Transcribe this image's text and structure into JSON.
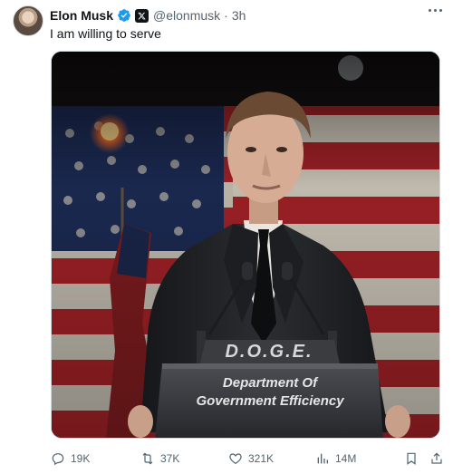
{
  "tweet": {
    "author": {
      "display_name": "Elon Musk",
      "handle": "@elonmusk",
      "verified_color": "#1d9bf0",
      "affiliation_icon": "x-logo-icon"
    },
    "separator": "·",
    "time": "3h",
    "text": "I am willing to serve",
    "media": {
      "podium_title": "D.O.G.E.",
      "podium_line1": "Department Of",
      "podium_line2": "Government Efficiency"
    },
    "actions": {
      "replies": "19K",
      "reposts": "37K",
      "likes": "321K",
      "views": "14M"
    }
  },
  "colors": {
    "text_primary": "#0f1419",
    "text_secondary": "#536471",
    "accent": "#1d9bf0",
    "flag_red": "#b3252b",
    "flag_blue": "#1f2f5c"
  }
}
